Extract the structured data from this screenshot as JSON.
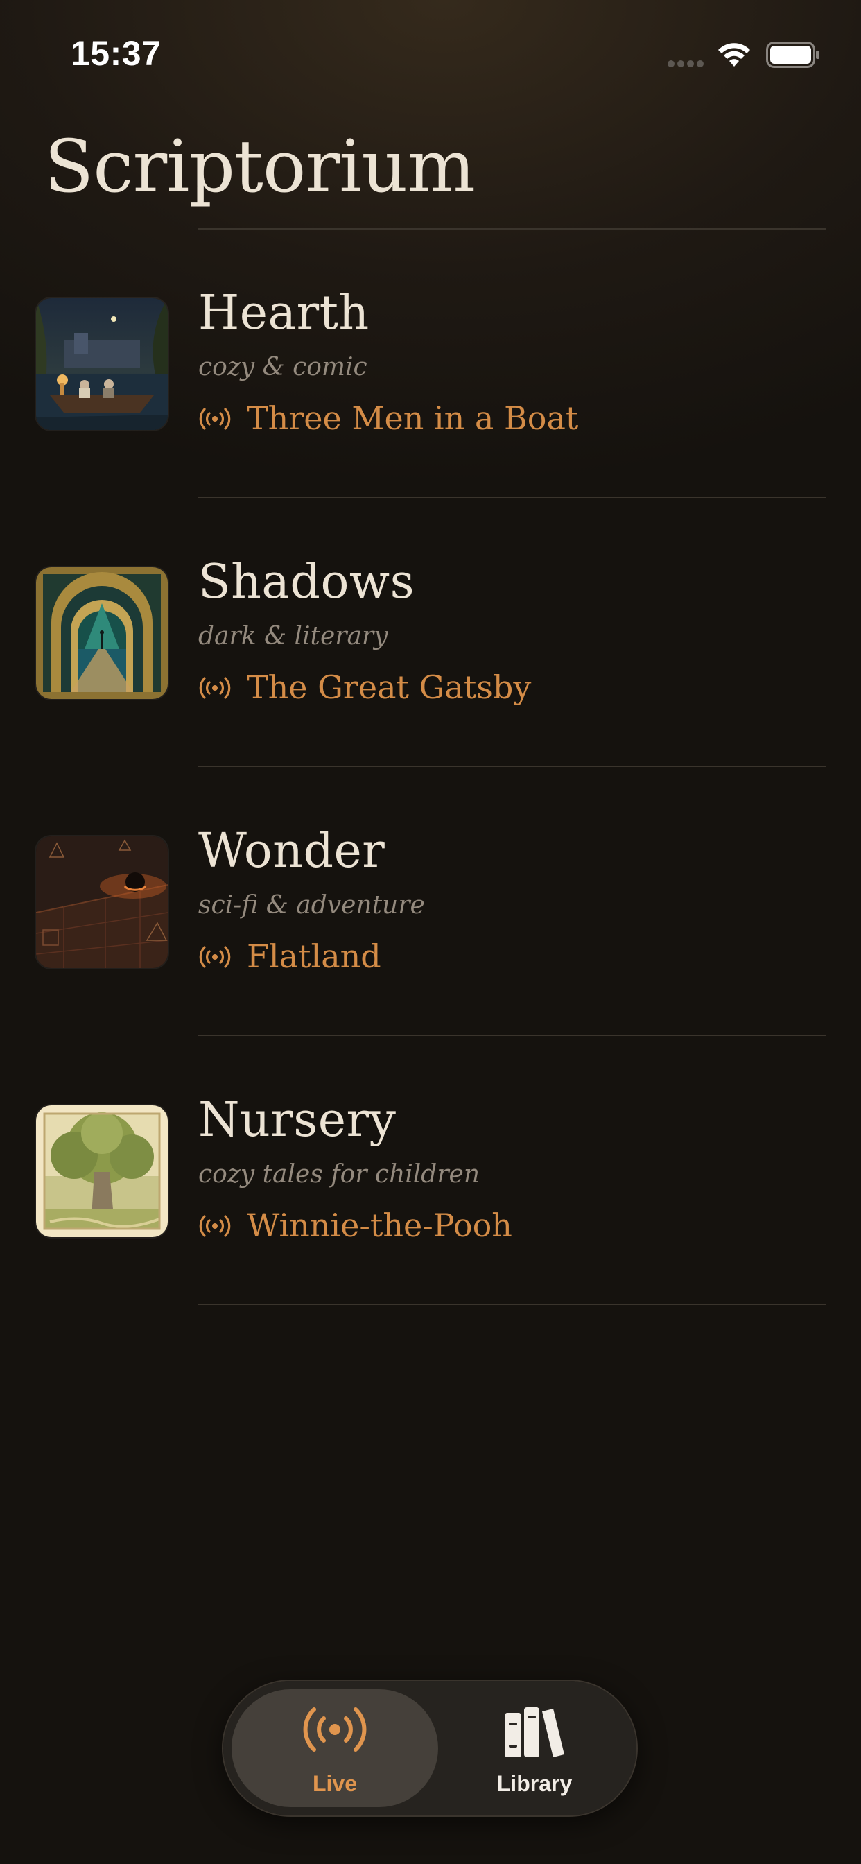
{
  "status_bar": {
    "time": "15:37"
  },
  "app": {
    "title": "Scriptorium"
  },
  "rooms": [
    {
      "name": "Hearth",
      "genre": "cozy & comic",
      "now_playing": "Three Men in a Boat",
      "cover_icon": "boat-at-night-illustration"
    },
    {
      "name": "Shadows",
      "genre": "dark & literary",
      "now_playing": "The Great Gatsby",
      "cover_icon": "art-deco-green-light-illustration"
    },
    {
      "name": "Wonder",
      "genre": "sci-fi & adventure",
      "now_playing": "Flatland",
      "cover_icon": "geometric-plane-illustration"
    },
    {
      "name": "Nursery",
      "genre": "cozy tales for children",
      "now_playing": "Winnie-the-Pooh",
      "cover_icon": "storybook-tree-illustration"
    }
  ],
  "tab_bar": {
    "tabs": [
      {
        "label": "Live",
        "icon": "broadcast-icon",
        "selected": true
      },
      {
        "label": "Library",
        "icon": "books-icon",
        "selected": false
      }
    ]
  },
  "colors": {
    "accent": "#d48c47",
    "background": "#15120e",
    "title_text": "#ece3d4",
    "subtitle_text": "#948a7e"
  }
}
